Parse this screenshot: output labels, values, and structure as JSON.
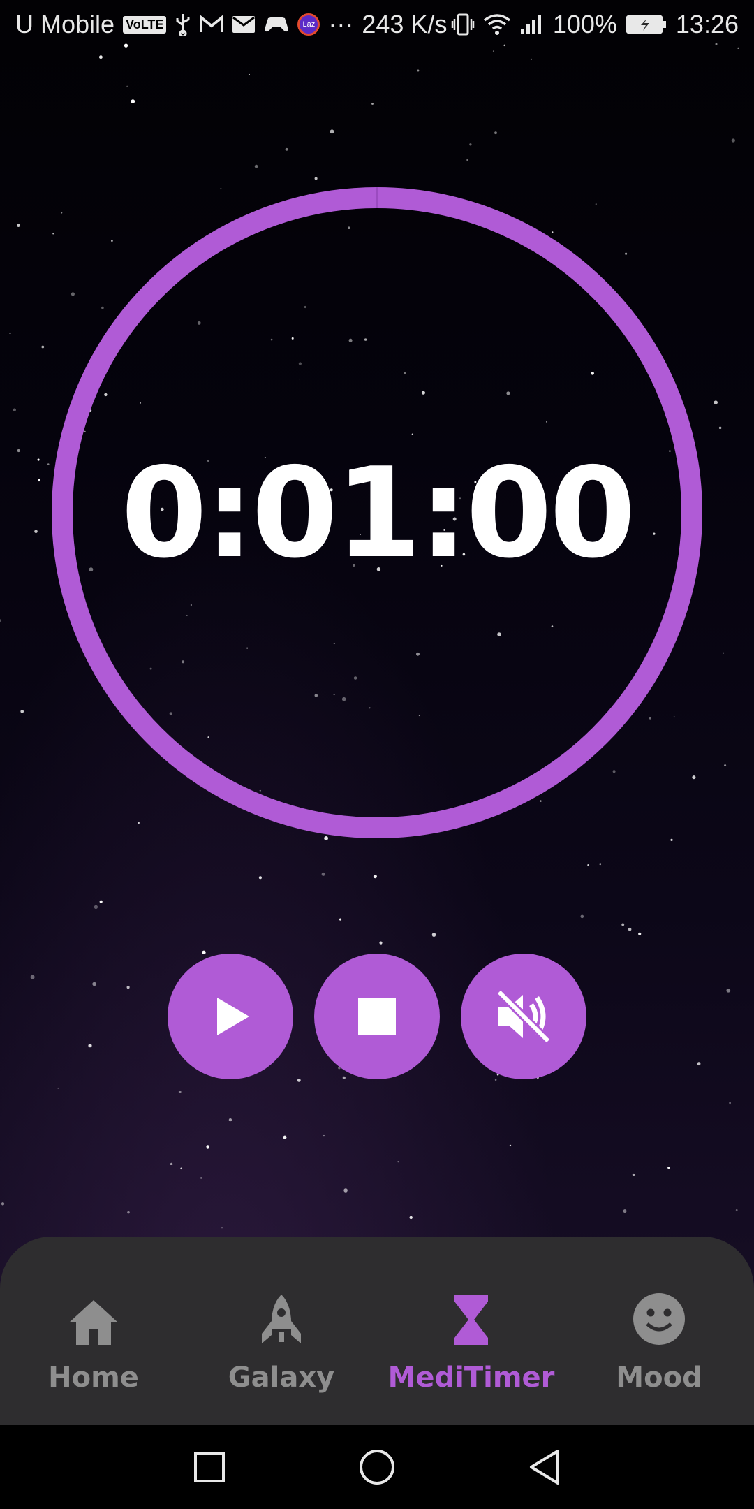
{
  "status_bar": {
    "carrier": "U Mobile",
    "volte": "VoLTE",
    "lazada": "Laz",
    "overflow": "···",
    "speed": "243 K/s",
    "battery": "100%",
    "time": "13:26"
  },
  "timer": {
    "display": "0:01:00",
    "progress": 1.0,
    "ring_color": "#b05bd6"
  },
  "controls": [
    {
      "name": "play",
      "icon": "play-icon"
    },
    {
      "name": "stop",
      "icon": "stop-icon"
    },
    {
      "name": "mute",
      "icon": "volume-off-icon"
    }
  ],
  "nav": {
    "items": [
      {
        "label": "Home",
        "icon": "home-icon",
        "active": false
      },
      {
        "label": "Galaxy",
        "icon": "rocket-icon",
        "active": false
      },
      {
        "label": "MediTimer",
        "icon": "hourglass-icon",
        "active": true
      },
      {
        "label": "Mood",
        "icon": "smiley-icon",
        "active": false
      }
    ]
  },
  "colors": {
    "accent": "#b05bd6",
    "nav_bg": "#2e2d2f",
    "nav_inactive": "#8e8e8e"
  }
}
